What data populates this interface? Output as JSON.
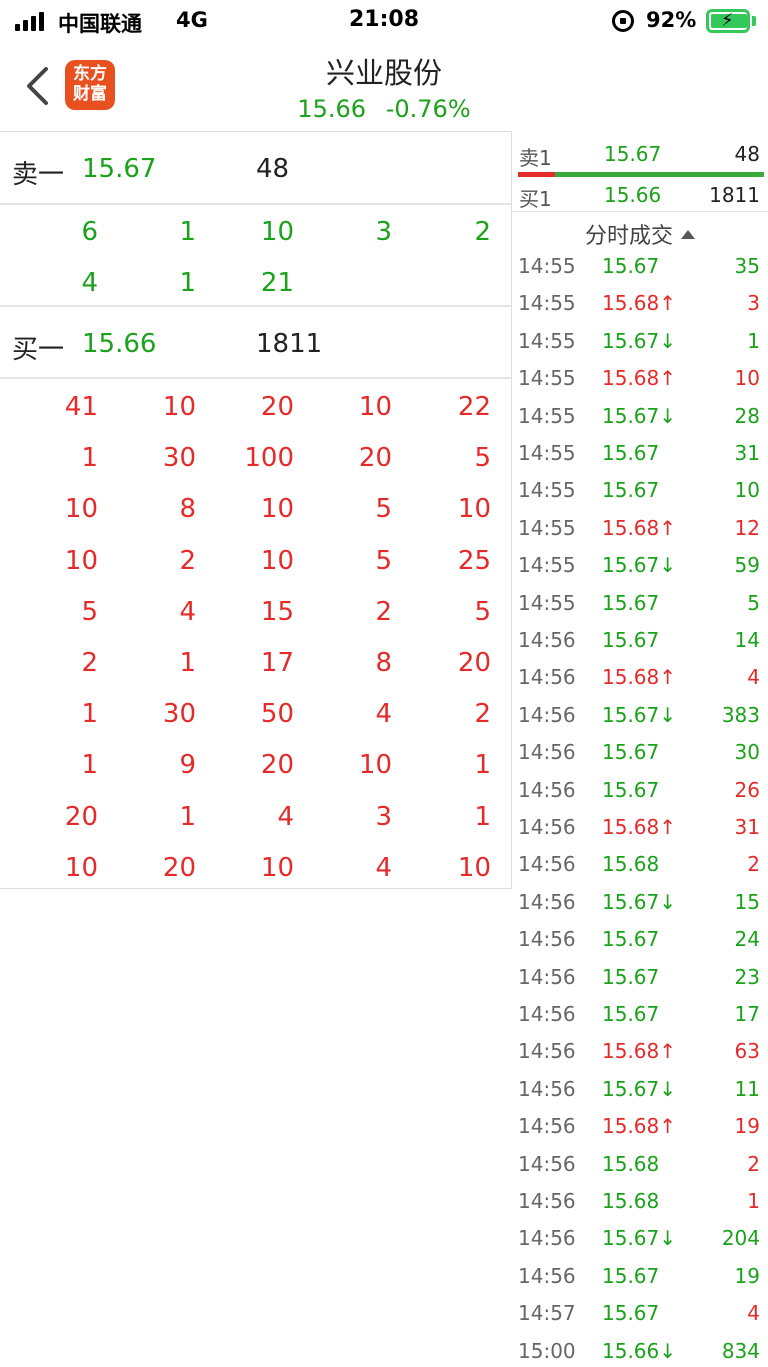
{
  "status_bar": {
    "carrier": "中国联通",
    "network": "4G",
    "time": "21:08",
    "battery": "92%"
  },
  "header": {
    "logo_text": "东方财富",
    "title": "兴业股份",
    "price": "15.66",
    "change": "-0.76%"
  },
  "left_panel": {
    "sell1": {
      "label": "卖一",
      "price": "15.67",
      "qty": "48"
    },
    "sell_orders": [
      [
        "6",
        "1",
        "10",
        "3",
        "2"
      ],
      [
        "4",
        "1",
        "21"
      ]
    ],
    "buy1": {
      "label": "买一",
      "price": "15.66",
      "qty": "1811"
    },
    "buy_orders": [
      [
        "41",
        "10",
        "20",
        "10",
        "22"
      ],
      [
        "1",
        "30",
        "100",
        "20",
        "5"
      ],
      [
        "10",
        "8",
        "10",
        "5",
        "10"
      ],
      [
        "10",
        "2",
        "10",
        "5",
        "25"
      ],
      [
        "5",
        "4",
        "15",
        "2",
        "5"
      ],
      [
        "2",
        "1",
        "17",
        "8",
        "20"
      ],
      [
        "1",
        "30",
        "50",
        "4",
        "2"
      ],
      [
        "1",
        "9",
        "20",
        "10",
        "1"
      ],
      [
        "20",
        "1",
        "4",
        "3",
        "1"
      ],
      [
        "10",
        "20",
        "10",
        "4",
        "10"
      ]
    ]
  },
  "order_book": {
    "ask": {
      "label": "卖1",
      "price": "15.67",
      "qty": "48"
    },
    "bid": {
      "label": "买1",
      "price": "15.66",
      "qty": "1811"
    },
    "sell_share": 0.15
  },
  "ticks_header": "分时成交",
  "ticks": [
    {
      "t": "14:55",
      "p": "15.67",
      "dir": "",
      "v": "35",
      "vc": "g"
    },
    {
      "t": "14:55",
      "p": "15.68",
      "dir": "↑",
      "v": "3",
      "vc": "r"
    },
    {
      "t": "14:55",
      "p": "15.67",
      "dir": "↓",
      "v": "1",
      "vc": "g"
    },
    {
      "t": "14:55",
      "p": "15.68",
      "dir": "↑",
      "v": "10",
      "vc": "r"
    },
    {
      "t": "14:55",
      "p": "15.67",
      "dir": "↓",
      "v": "28",
      "vc": "g"
    },
    {
      "t": "14:55",
      "p": "15.67",
      "dir": "",
      "v": "31",
      "vc": "g"
    },
    {
      "t": "14:55",
      "p": "15.67",
      "dir": "",
      "v": "10",
      "vc": "g"
    },
    {
      "t": "14:55",
      "p": "15.68",
      "dir": "↑",
      "v": "12",
      "vc": "r"
    },
    {
      "t": "14:55",
      "p": "15.67",
      "dir": "↓",
      "v": "59",
      "vc": "g"
    },
    {
      "t": "14:55",
      "p": "15.67",
      "dir": "",
      "v": "5",
      "vc": "g"
    },
    {
      "t": "14:56",
      "p": "15.67",
      "dir": "",
      "v": "14",
      "vc": "g"
    },
    {
      "t": "14:56",
      "p": "15.68",
      "dir": "↑",
      "v": "4",
      "vc": "r"
    },
    {
      "t": "14:56",
      "p": "15.67",
      "dir": "↓",
      "v": "383",
      "vc": "g"
    },
    {
      "t": "14:56",
      "p": "15.67",
      "dir": "",
      "v": "30",
      "vc": "g"
    },
    {
      "t": "14:56",
      "p": "15.67",
      "dir": "",
      "v": "26",
      "vc": "r"
    },
    {
      "t": "14:56",
      "p": "15.68",
      "dir": "↑",
      "v": "31",
      "vc": "r"
    },
    {
      "t": "14:56",
      "p": "15.68",
      "dir": "",
      "v": "2",
      "vc": "r"
    },
    {
      "t": "14:56",
      "p": "15.67",
      "dir": "↓",
      "v": "15",
      "vc": "g"
    },
    {
      "t": "14:56",
      "p": "15.67",
      "dir": "",
      "v": "24",
      "vc": "g"
    },
    {
      "t": "14:56",
      "p": "15.67",
      "dir": "",
      "v": "23",
      "vc": "g"
    },
    {
      "t": "14:56",
      "p": "15.67",
      "dir": "",
      "v": "17",
      "vc": "g"
    },
    {
      "t": "14:56",
      "p": "15.68",
      "dir": "↑",
      "v": "63",
      "vc": "r"
    },
    {
      "t": "14:56",
      "p": "15.67",
      "dir": "↓",
      "v": "11",
      "vc": "g"
    },
    {
      "t": "14:56",
      "p": "15.68",
      "dir": "↑",
      "v": "19",
      "vc": "r"
    },
    {
      "t": "14:56",
      "p": "15.68",
      "dir": "",
      "v": "2",
      "vc": "r"
    },
    {
      "t": "14:56",
      "p": "15.68",
      "dir": "",
      "v": "1",
      "vc": "r"
    },
    {
      "t": "14:56",
      "p": "15.67",
      "dir": "↓",
      "v": "204",
      "vc": "g"
    },
    {
      "t": "14:56",
      "p": "15.67",
      "dir": "",
      "v": "19",
      "vc": "g"
    },
    {
      "t": "14:57",
      "p": "15.67",
      "dir": "",
      "v": "4",
      "vc": "r"
    },
    {
      "t": "15:00",
      "p": "15.66",
      "dir": "↓",
      "v": "834",
      "vc": "g"
    }
  ],
  "colors": {
    "up": "#e52a2a",
    "down": "#1aa21a"
  }
}
